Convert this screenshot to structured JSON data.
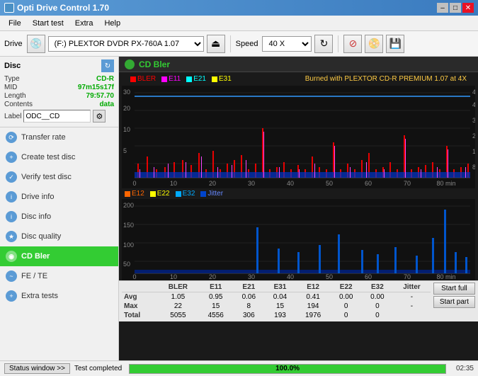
{
  "titleBar": {
    "icon": "app-icon",
    "title": "Opti Drive Control 1.70",
    "minBtn": "–",
    "maxBtn": "□",
    "closeBtn": "✕"
  },
  "menuBar": {
    "items": [
      "File",
      "Start test",
      "Extra",
      "Help"
    ]
  },
  "toolbar": {
    "driveLabel": "Drive",
    "driveValue": "(F:)  PLEXTOR DVDR  PX-760A 1.07",
    "speedLabel": "Speed",
    "speedValue": "40 X"
  },
  "sidebar": {
    "disc": {
      "header": "Disc",
      "rows": [
        {
          "key": "Type",
          "val": "CD-R"
        },
        {
          "key": "MID",
          "val": "97m15s17f"
        },
        {
          "key": "Length",
          "val": "79:57.70"
        },
        {
          "key": "Contents",
          "val": "data"
        }
      ],
      "labelKey": "Label",
      "labelValue": "ODC__CD"
    },
    "items": [
      {
        "label": "Transfer rate",
        "active": false
      },
      {
        "label": "Create test disc",
        "active": false
      },
      {
        "label": "Verify test disc",
        "active": false
      },
      {
        "label": "Drive info",
        "active": false
      },
      {
        "label": "Disc info",
        "active": false
      },
      {
        "label": "Disc quality",
        "active": false
      },
      {
        "label": "CD Bler",
        "active": true
      },
      {
        "label": "FE / TE",
        "active": false
      },
      {
        "label": "Extra tests",
        "active": false
      }
    ]
  },
  "content": {
    "title": "CD Bler",
    "topLegend": [
      {
        "label": "BLER",
        "color": "#ff0000"
      },
      {
        "label": "E11",
        "color": "#ff00ff"
      },
      {
        "label": "E21",
        "color": "#00ffff"
      },
      {
        "label": "E31",
        "color": "#ffff00"
      }
    ],
    "topInfo": "Burned with PLEXTOR CD-R  PREMIUM 1.07 at 4X",
    "bottomLegend": [
      {
        "label": "E12",
        "color": "#ff6600"
      },
      {
        "label": "E22",
        "color": "#ffff00"
      },
      {
        "label": "E32",
        "color": "#00aaff"
      },
      {
        "label": "Jitter",
        "color": "#0000cc"
      }
    ]
  },
  "stats": {
    "columns": [
      "BLER",
      "E11",
      "E21",
      "E31",
      "E12",
      "E22",
      "E32",
      "Jitter"
    ],
    "rows": [
      {
        "label": "Avg",
        "vals": [
          "1.05",
          "0.95",
          "0.06",
          "0.04",
          "0.41",
          "0.00",
          "0.00",
          "-"
        ]
      },
      {
        "label": "Max",
        "vals": [
          "22",
          "15",
          "8",
          "15",
          "194",
          "0",
          "0",
          "-"
        ]
      },
      {
        "label": "Total",
        "vals": [
          "5055",
          "4556",
          "306",
          "193",
          "1976",
          "0",
          "0",
          ""
        ]
      }
    ],
    "startFullBtn": "Start full",
    "startPartBtn": "Start part"
  },
  "statusBar": {
    "windowBtn": "Status window >>",
    "statusText": "Test completed",
    "progress": 100,
    "progressText": "100.0%",
    "time": "02:35"
  }
}
